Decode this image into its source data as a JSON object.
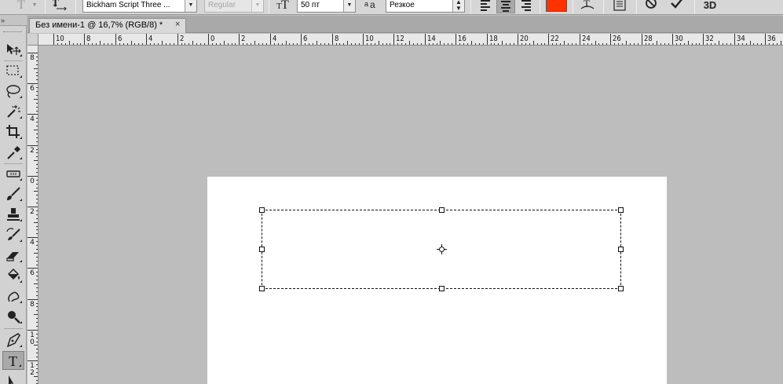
{
  "options_bar": {
    "tool_preset_icon": "text-tool-preset-icon",
    "orientation_icon": "text-orientation-toggle-icon",
    "font_family": "Bickham Script Three ...",
    "font_style": "Regular",
    "font_size_icon": "font-size-icon",
    "font_size": "50 пт",
    "antialias_icon": "antialiasing-icon",
    "antialias": "Резкое",
    "align_left_icon": "align-left-icon",
    "align_center_icon": "align-center-icon",
    "align_right_icon": "align-right-icon",
    "text_color": "#ff3300",
    "warp_icon": "warp-text-icon",
    "panels_icon": "character-paragraph-panels-icon",
    "cancel_icon": "cancel-icon",
    "commit_icon": "commit-checkmark-icon",
    "label_3d": "3D"
  },
  "document_tab": {
    "title": "Без имени-1 @ 16,7% (RGB/8) *",
    "close": "×"
  },
  "toolbox": {
    "collapse_glyph": "»",
    "active_tool": "text-tool"
  },
  "rulers": {
    "top_labels": [
      "10",
      "8",
      "6",
      "4",
      "2",
      "0",
      "2",
      "4",
      "6",
      "8",
      "10",
      "12",
      "14",
      "16",
      "18",
      "20",
      "22",
      "24",
      "26",
      "28",
      "30",
      "32",
      "34",
      "36"
    ],
    "left_labels": [
      "8",
      "6",
      "4",
      "2",
      "0",
      "2",
      "4",
      "6",
      "8",
      "10",
      "12"
    ]
  },
  "colors": {
    "workspace": "#bdbdbd",
    "canvas": "#ffffff",
    "text_color": "#ff3300"
  }
}
